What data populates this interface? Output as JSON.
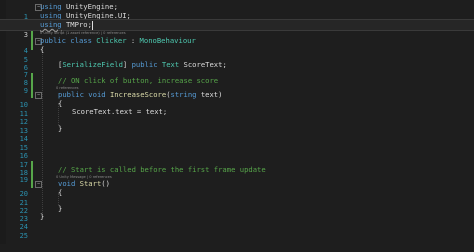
{
  "editor": {
    "lines": {
      "l1": {
        "num": "1",
        "t1": "using",
        "t2": " UnityEngine;"
      },
      "l2": {
        "num": "2",
        "t1": "using",
        "t2": " UnityEngine.UI;"
      },
      "l3": {
        "num": "3",
        "t1": "using",
        "t2": " TMPro;"
      },
      "lens_class": "0 Unity Script (1 asset reference) | 0 references",
      "l4": {
        "num": "4",
        "t1": "public",
        "t2": " ",
        "t3": "class",
        "t4": " ",
        "t5": "Clicker",
        "t6": " : ",
        "t7": "MonoBehaviour"
      },
      "l5": {
        "num": "5",
        "t1": "{"
      },
      "l6": {
        "num": "6"
      },
      "l7": {
        "num": "7",
        "t0": "[",
        "t1": "SerializeField",
        "t2": "] ",
        "t3": "public",
        "t4": " ",
        "t5": "Text",
        "t6": " ScoreText;"
      },
      "l8": {
        "num": "8"
      },
      "l9": {
        "num": "9",
        "t1": "// ON click of button, increase score"
      },
      "lens_method": "0 references",
      "l10": {
        "num": "10",
        "t1": "public",
        "t2": " ",
        "t3": "void",
        "t4": " ",
        "t5": "IncreaseScore",
        "t6": "(",
        "t7": "string",
        "t8": " text)"
      },
      "l11": {
        "num": "11",
        "t1": "{"
      },
      "l12": {
        "num": "12",
        "t1": "ScoreText.text = text;"
      },
      "l13": {
        "num": "13"
      },
      "l14": {
        "num": "14",
        "t1": "}"
      },
      "l15": {
        "num": "15"
      },
      "l16": {
        "num": "16"
      },
      "l17": {
        "num": "17"
      },
      "l18": {
        "num": "18"
      },
      "l19": {
        "num": "19",
        "t1": "// Start is called before the first frame update"
      },
      "lens_start": "0 Unity Message | 0 references",
      "l20": {
        "num": "20",
        "t1": "void",
        "t2": " ",
        "t3": "Start",
        "t4": "()"
      },
      "l21": {
        "num": "21",
        "t1": "{"
      },
      "l22": {
        "num": "22"
      },
      "l23": {
        "num": "23",
        "t1": "}"
      },
      "l24": {
        "num": "24",
        "t1": "}"
      },
      "l25": {
        "num": "25"
      }
    }
  },
  "colors": {
    "background": "#1e1e1e",
    "keyword": "#569cd6",
    "type": "#4ec9b0",
    "comment": "#57a64a",
    "method": "#dcdcaa",
    "line_number": "#2b91af"
  }
}
